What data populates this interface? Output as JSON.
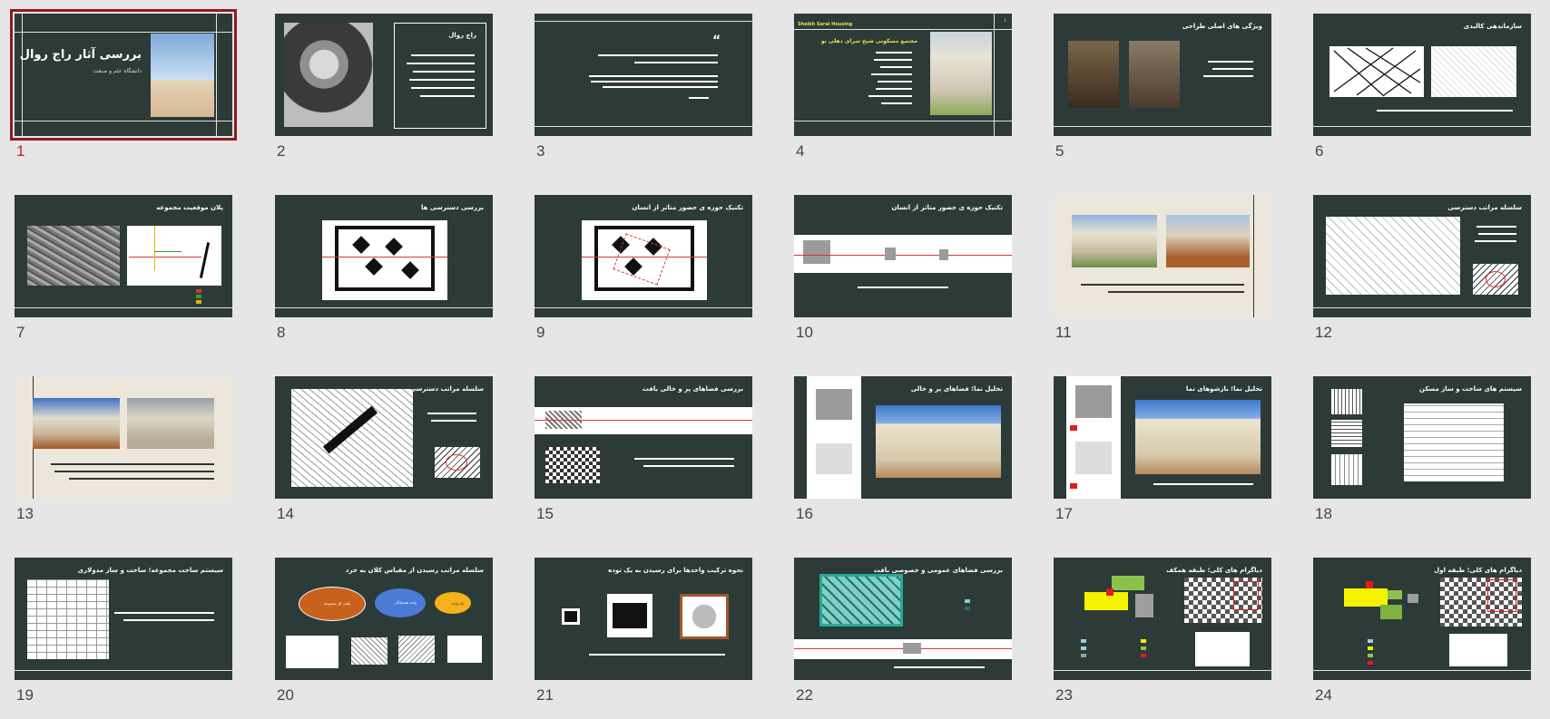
{
  "slide_numbers": [
    "1",
    "2",
    "3",
    "4",
    "5",
    "6",
    "7",
    "8",
    "9",
    "10",
    "11",
    "12",
    "13",
    "14",
    "15",
    "16",
    "17",
    "18",
    "19",
    "20",
    "21",
    "22",
    "23",
    "24"
  ],
  "slides": {
    "s1": {
      "title": "بررسی آثار راج روال",
      "subtitle": "دانشگاه علم و صنعت"
    },
    "s2": {
      "title": "راج روال"
    },
    "s3": {
      "quote_mark": "“"
    },
    "s4": {
      "header_en": "Sheikh Sarai Housing",
      "title": "مجتمع مسکونی شیخ سرای دهلی نو",
      "page": "1"
    },
    "s5": {
      "title": "ویژگی های اصلی طراحی"
    },
    "s6": {
      "title": "سازماندهی کالبدی"
    },
    "s7": {
      "title": "پلان موقعیت مجموعه"
    },
    "s8": {
      "title": "بررسی دسترسی ها"
    },
    "s9": {
      "title": "تکنیک حوزه ی حضور متاثر از انسان"
    },
    "s10": {
      "title": "تکنیک حوزه ی حضور متاثر از انسان"
    },
    "s12": {
      "title": "سلسله مراتب دسترسی"
    },
    "s14": {
      "title": "سلسله مراتب دسترسی"
    },
    "s15": {
      "title": "بررسی فضاهای پر و خالی بافت"
    },
    "s16": {
      "title": "تحلیل نما؛ فضاهای پر و خالی"
    },
    "s17": {
      "title": "تحلیل نما؛ بازشوهای نما"
    },
    "s18": {
      "title": "سیستم های ساخت و ساز مسکن"
    },
    "s19": {
      "title": "سیستم ساخت مجموعه؛ ساخت و ساز مدولاری"
    },
    "s20": {
      "title": "سلسله مراتب رسیدن از مقیاس کلان به خرد",
      "ellipses": [
        "بافت کل مجموعه",
        "واحد همسایگی",
        "تک واحد"
      ]
    },
    "s21": {
      "title": "نحوه ترکیب واحدها برای رسیدن به یک توده"
    },
    "s22": {
      "title": "بررسی فضاهای عمومی و خصوصی بافت"
    },
    "s23": {
      "title": "دیاگرام های کلی؛ طبقه همکف"
    },
    "s24": {
      "title": "دیاگرام های کلی؛ طبقه اول"
    }
  },
  "colors": {
    "slide_bg": "#2c3a38",
    "selection": "#8e1b1b",
    "light_bg": "#ece7da"
  }
}
